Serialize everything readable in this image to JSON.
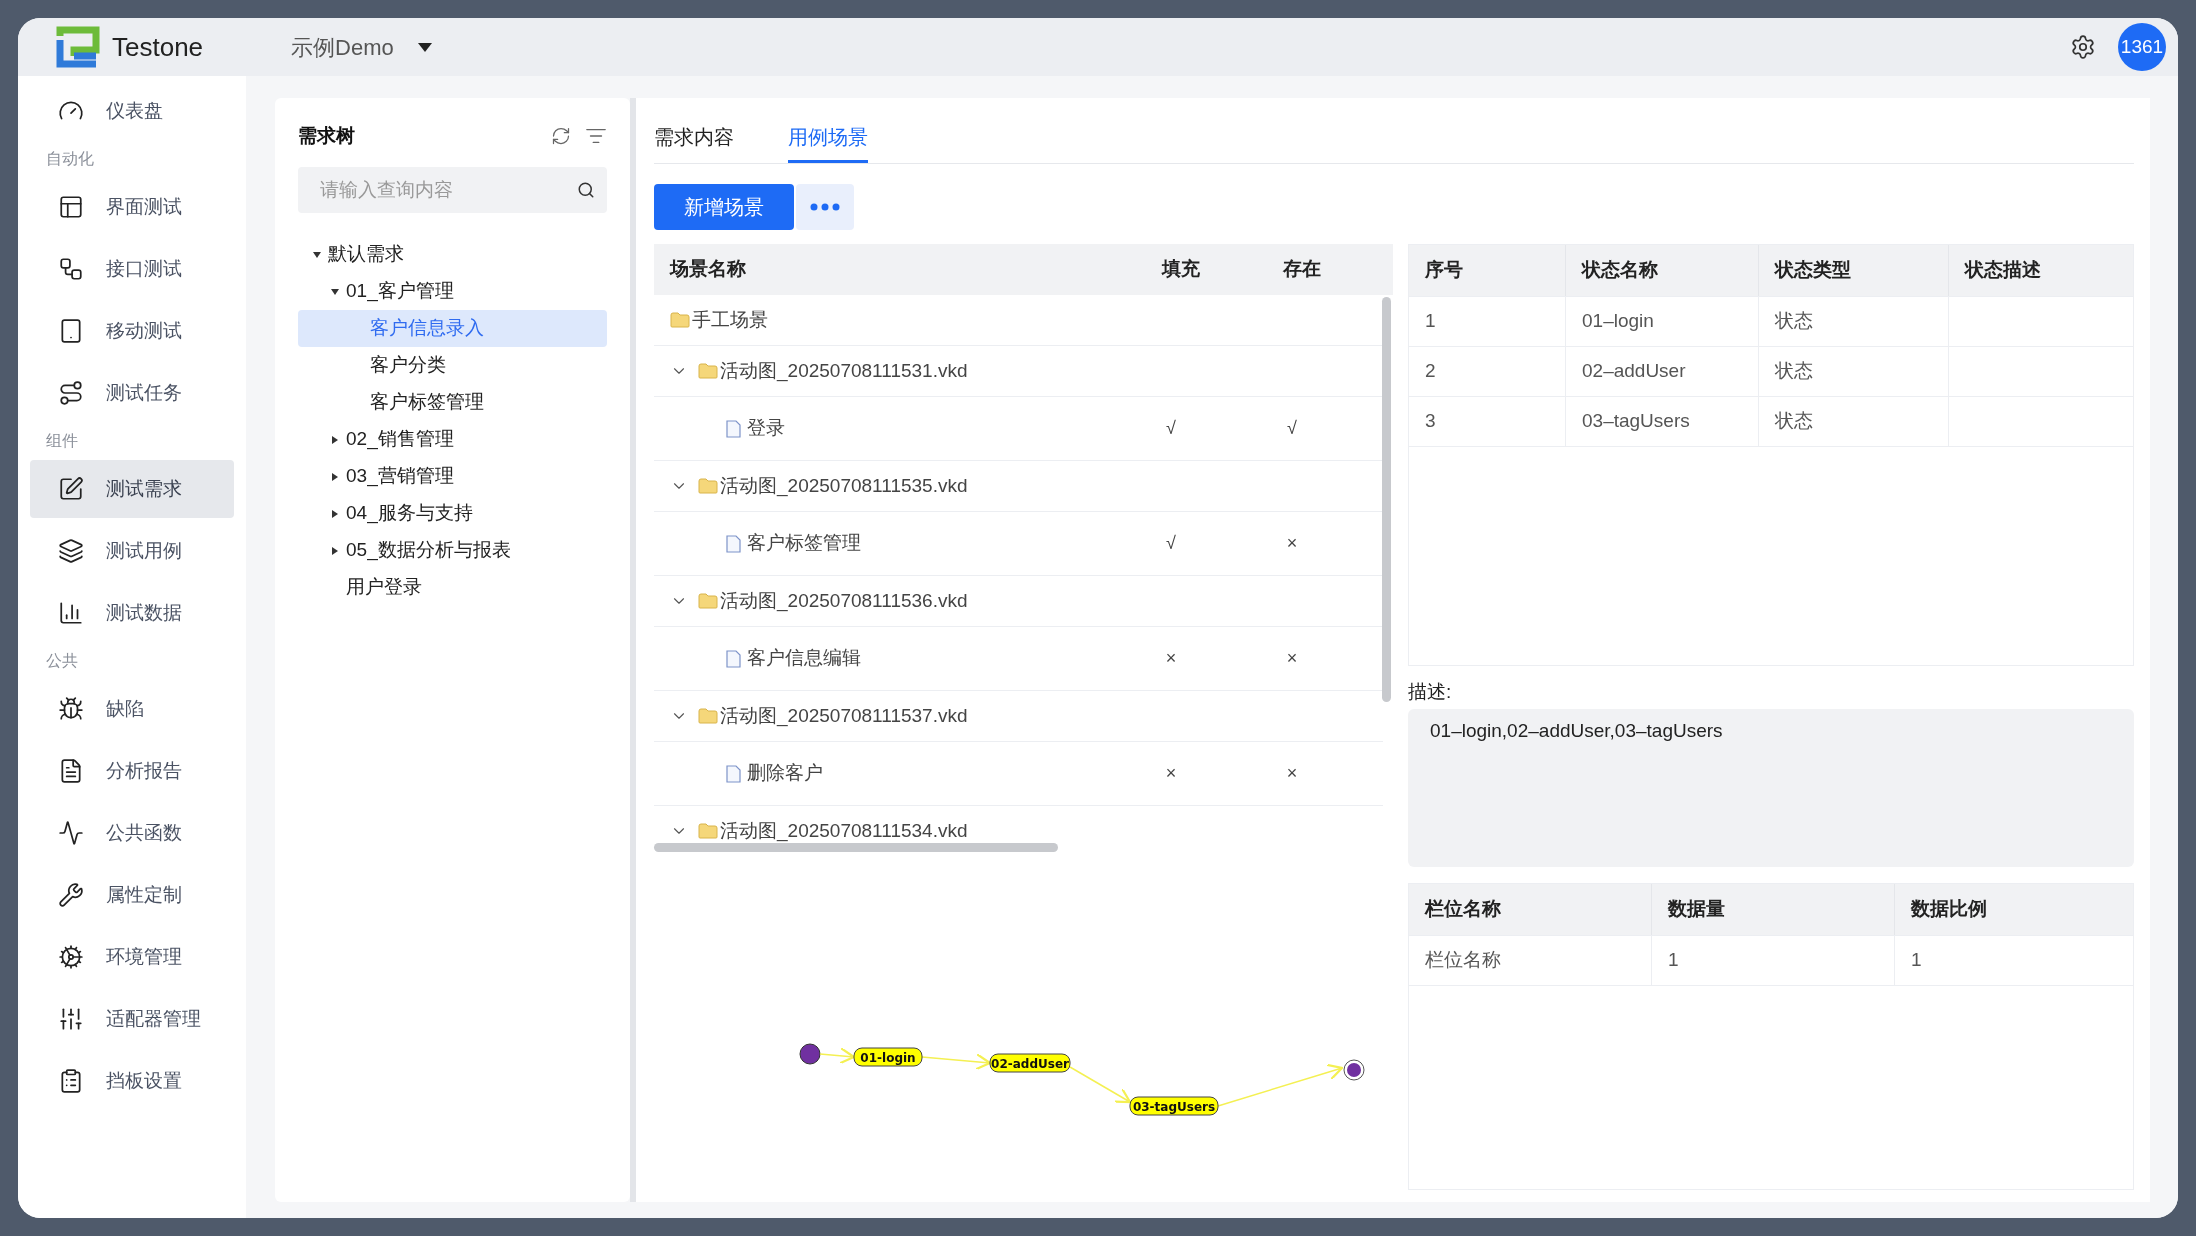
{
  "header": {
    "brand": "Testone",
    "project": "示例Demo",
    "avatar": "1361"
  },
  "sidebar": {
    "groups": [
      {
        "items": [
          {
            "label": "仪表盘",
            "selected": false
          }
        ]
      },
      {
        "label": "自动化",
        "items": [
          {
            "label": "界面测试",
            "selected": false
          },
          {
            "label": "接口测试",
            "selected": false
          },
          {
            "label": "移动测试",
            "selected": false
          },
          {
            "label": "测试任务",
            "selected": false
          }
        ]
      },
      {
        "label": "组件",
        "items": [
          {
            "label": "测试需求",
            "selected": true
          },
          {
            "label": "测试用例",
            "selected": false
          },
          {
            "label": "测试数据",
            "selected": false
          }
        ]
      },
      {
        "label": "公共",
        "items": [
          {
            "label": "缺陷",
            "selected": false
          },
          {
            "label": "分析报告",
            "selected": false
          },
          {
            "label": "公共函数",
            "selected": false
          },
          {
            "label": "属性定制",
            "selected": false
          },
          {
            "label": "环境管理",
            "selected": false
          },
          {
            "label": "适配器管理",
            "selected": false
          },
          {
            "label": "挡板设置",
            "selected": false
          }
        ]
      }
    ]
  },
  "tree": {
    "title": "需求树",
    "search": {
      "placeholder": "请输入查询内容"
    },
    "items": [
      {
        "label": "默认需求",
        "expanded": true,
        "selected": false,
        "children": [
          {
            "label": "01_客户管理",
            "expanded": true,
            "selected": false,
            "children": [
              {
                "label": "客户信息录入",
                "selected": true
              },
              {
                "label": "客户分类",
                "selected": false
              },
              {
                "label": "客户标签管理",
                "selected": false
              }
            ]
          },
          {
            "label": "02_销售管理",
            "expanded": false,
            "selected": false
          },
          {
            "label": "03_营销管理",
            "expanded": false,
            "selected": false
          },
          {
            "label": "04_服务与支持",
            "expanded": false,
            "selected": false
          },
          {
            "label": "05_数据分析与报表",
            "expanded": false,
            "selected": false
          },
          {
            "label": "用户登录",
            "selected": false
          }
        ]
      }
    ]
  },
  "tabs": [
    {
      "label": "需求内容",
      "selected": false
    },
    {
      "label": "用例场景",
      "selected": true
    }
  ],
  "toolbar": {
    "add": "新增场景"
  },
  "scenarios": {
    "columns": [
      "场景名称",
      "填充",
      "存在"
    ],
    "rows": [
      {
        "kind": "plain-folder",
        "name": "手工场景"
      },
      {
        "kind": "folder",
        "name": "活动图_20250708111531.vkd",
        "expanded": true,
        "children": [
          {
            "name": "登录",
            "fill": "√",
            "exist": "√"
          }
        ]
      },
      {
        "kind": "folder",
        "name": "活动图_20250708111535.vkd",
        "expanded": true,
        "children": [
          {
            "name": "客户标签管理",
            "fill": "√",
            "exist": "×"
          }
        ]
      },
      {
        "kind": "folder",
        "name": "活动图_20250708111536.vkd",
        "expanded": true,
        "children": [
          {
            "name": "客户信息编辑",
            "fill": "×",
            "exist": "×"
          }
        ]
      },
      {
        "kind": "folder",
        "name": "活动图_20250708111537.vkd",
        "expanded": true,
        "children": [
          {
            "name": "删除客户",
            "fill": "×",
            "exist": "×"
          }
        ]
      },
      {
        "kind": "folder",
        "name": "活动图_20250708111534.vkd",
        "expanded": true
      }
    ]
  },
  "diagram": {
    "states": [
      "01-login",
      "02-addUser",
      "03-tagUsers"
    ]
  },
  "states": {
    "columns": [
      "序号",
      "状态名称",
      "状态类型",
      "状态描述"
    ],
    "rows": [
      [
        "1",
        "01–login",
        "状态",
        ""
      ],
      [
        "2",
        "02–addUser",
        "状态",
        ""
      ],
      [
        "3",
        "03–tagUsers",
        "状态",
        ""
      ]
    ]
  },
  "description": {
    "label": "描述:",
    "text": "01–login,02–addUser,03–tagUsers"
  },
  "fields": {
    "columns": [
      "栏位名称",
      "数据量",
      "数据比例"
    ],
    "rows": [
      [
        "栏位名称",
        "1",
        "1"
      ]
    ]
  }
}
